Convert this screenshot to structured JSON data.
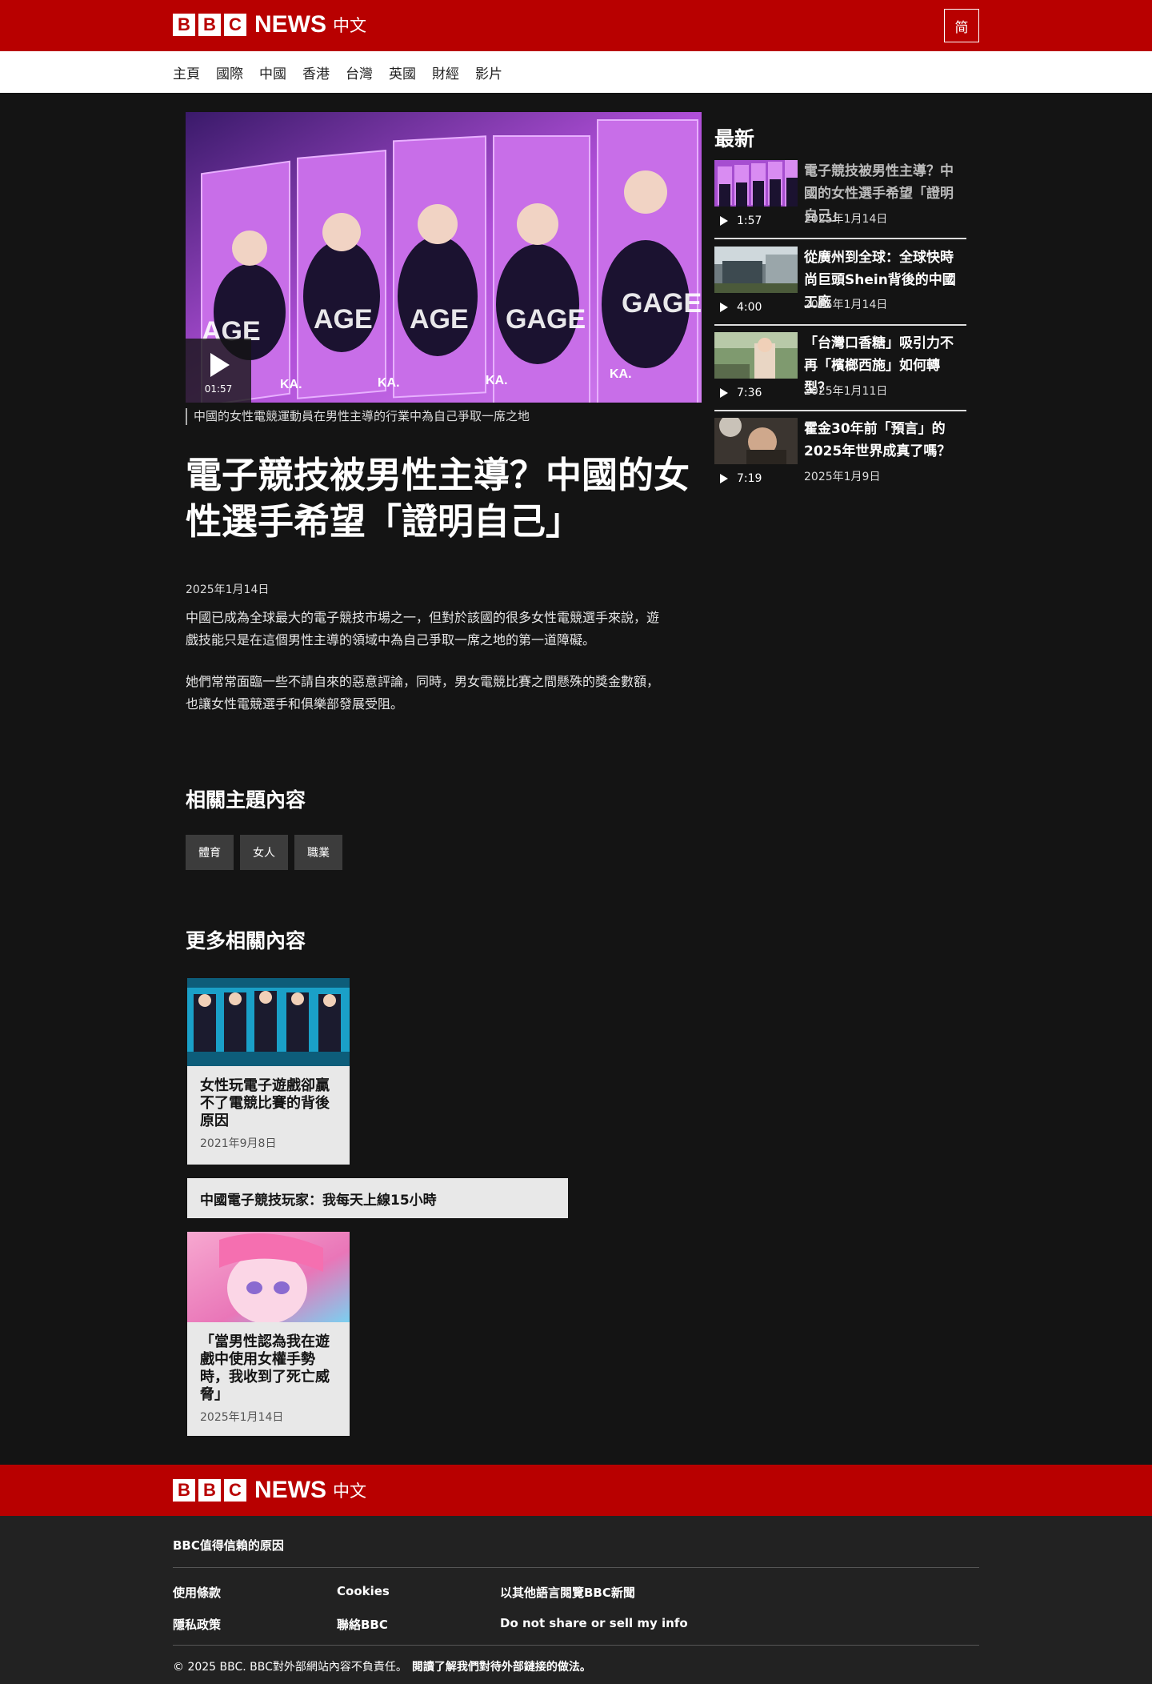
{
  "brand": {
    "letters": [
      "B",
      "B",
      "C"
    ],
    "news": "NEWS",
    "lang": "中文"
  },
  "header": {
    "script_toggle": "简"
  },
  "nav": {
    "items": [
      "主頁",
      "國際",
      "中國",
      "香港",
      "台灣",
      "英國",
      "財經",
      "影片"
    ]
  },
  "article": {
    "video_duration": "01:57",
    "caption": "中國的女性電競運動員在男性主導的行業中為自己爭取一席之地",
    "headline": "電子競技被男性主導？中國的女性選手希望「證明自己」",
    "date": "2025年1月14日",
    "paragraphs": [
      "中國已成為全球最大的電子競技市場之一，但對於該國的很多女性電競選手來說，遊戲技能只是在這個男性主導的領域中為自己爭取一席之地的第一道障礙。",
      "她們常常面臨一些不請自來的惡意評論，同時，男女電競比賽之間懸殊的獎金數額，也讓女性電競選手和俱樂部發展受阻。"
    ]
  },
  "topics": {
    "title": "相關主題內容",
    "tags": [
      "體育",
      "女人",
      "職業"
    ]
  },
  "more": {
    "title": "更多相關內容",
    "card1": {
      "title": "女性玩電子遊戲卻贏不了電競比賽的背後原因",
      "date": "2021年9月8日"
    },
    "wide": {
      "title": "中國電子競技玩家：我每天上線15小時"
    },
    "card3": {
      "title": "「當男性認為我在遊戲中使用女權手勢時，我收到了死亡威脅」",
      "date": "2025年1月14日"
    }
  },
  "latest": {
    "title": "最新",
    "items": [
      {
        "title": "電子競技被男性主導？中國的女性選手希望「證明自己」",
        "date": "2025年1月14日",
        "duration": "1:57"
      },
      {
        "title": "從廣州到全球：全球快時尚巨頭Shein背後的中國工廠",
        "date": "2025年1月14日",
        "duration": "4:00"
      },
      {
        "title": "「台灣口香糖」吸引力不再「檳榔西施」如何轉型？",
        "date": "2025年1月11日",
        "duration": "7:36"
      },
      {
        "title": "霍金30年前「預言」的2025年世界成真了嗎？",
        "date": "2025年1月9日",
        "duration": "7:19"
      }
    ]
  },
  "footer": {
    "trust": "BBC值得信賴的原因",
    "links": [
      "使用條款",
      "Cookies",
      "以其他語言閱覽BBC新聞",
      "隱私政策",
      "聯絡BBC",
      "Do not share or sell my info"
    ],
    "copyright": "© 2025 BBC. BBC對外部網站內容不負責任。",
    "external_link": "閱讀了解我們對待外部鏈接的做法。"
  },
  "colors": {
    "brand_red": "#b80000",
    "page_bg": "#141414",
    "card_bg": "#e8e8e8",
    "footer_bg": "#222222"
  }
}
